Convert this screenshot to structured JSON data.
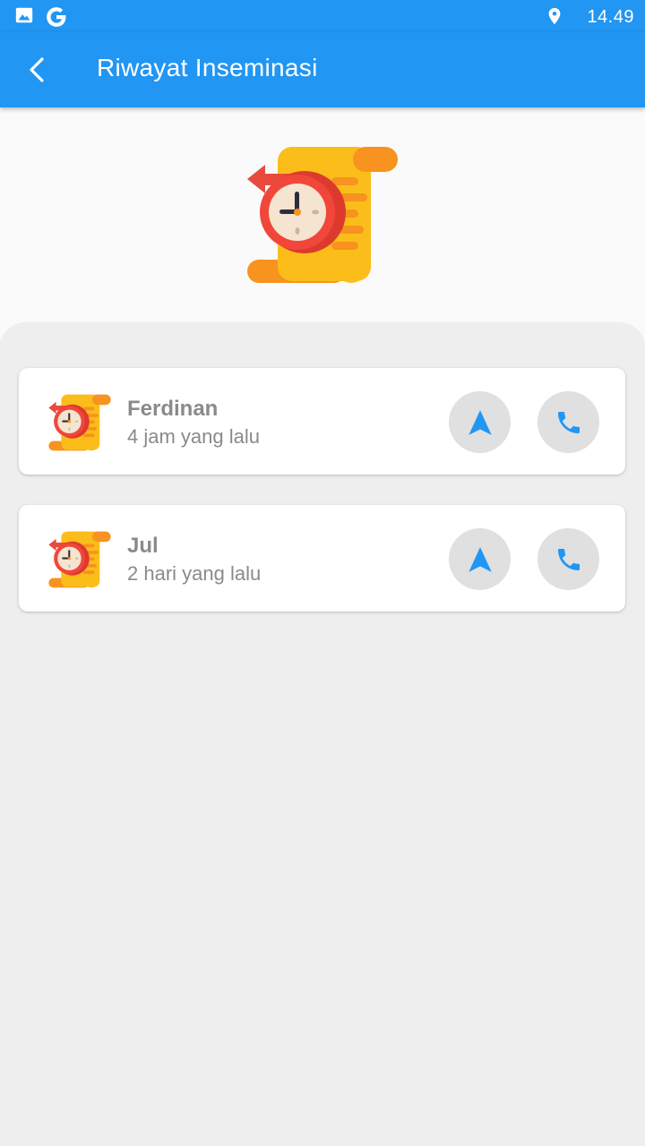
{
  "status_bar": {
    "time": "14.49",
    "icons": [
      "image-icon",
      "google-icon",
      "location-pin-icon"
    ]
  },
  "app_bar": {
    "title": "Riwayat Inseminasi",
    "back_icon": "chevron-left-icon"
  },
  "header": {
    "icon": "history-scroll-clock-icon"
  },
  "colors": {
    "primary": "#2196f3",
    "action_icon": "#2196f3",
    "action_button_bg": "#e0e0e0",
    "text_muted": "#8a8a8a"
  },
  "records": [
    {
      "name": "Ferdinan",
      "time_ago": "4 jam yang lalu",
      "icon": "history-scroll-clock-icon",
      "actions": [
        "navigation-arrow-icon",
        "phone-icon"
      ]
    },
    {
      "name": "Jul",
      "time_ago": "2 hari yang lalu",
      "icon": "history-scroll-clock-icon",
      "actions": [
        "navigation-arrow-icon",
        "phone-icon"
      ]
    }
  ]
}
